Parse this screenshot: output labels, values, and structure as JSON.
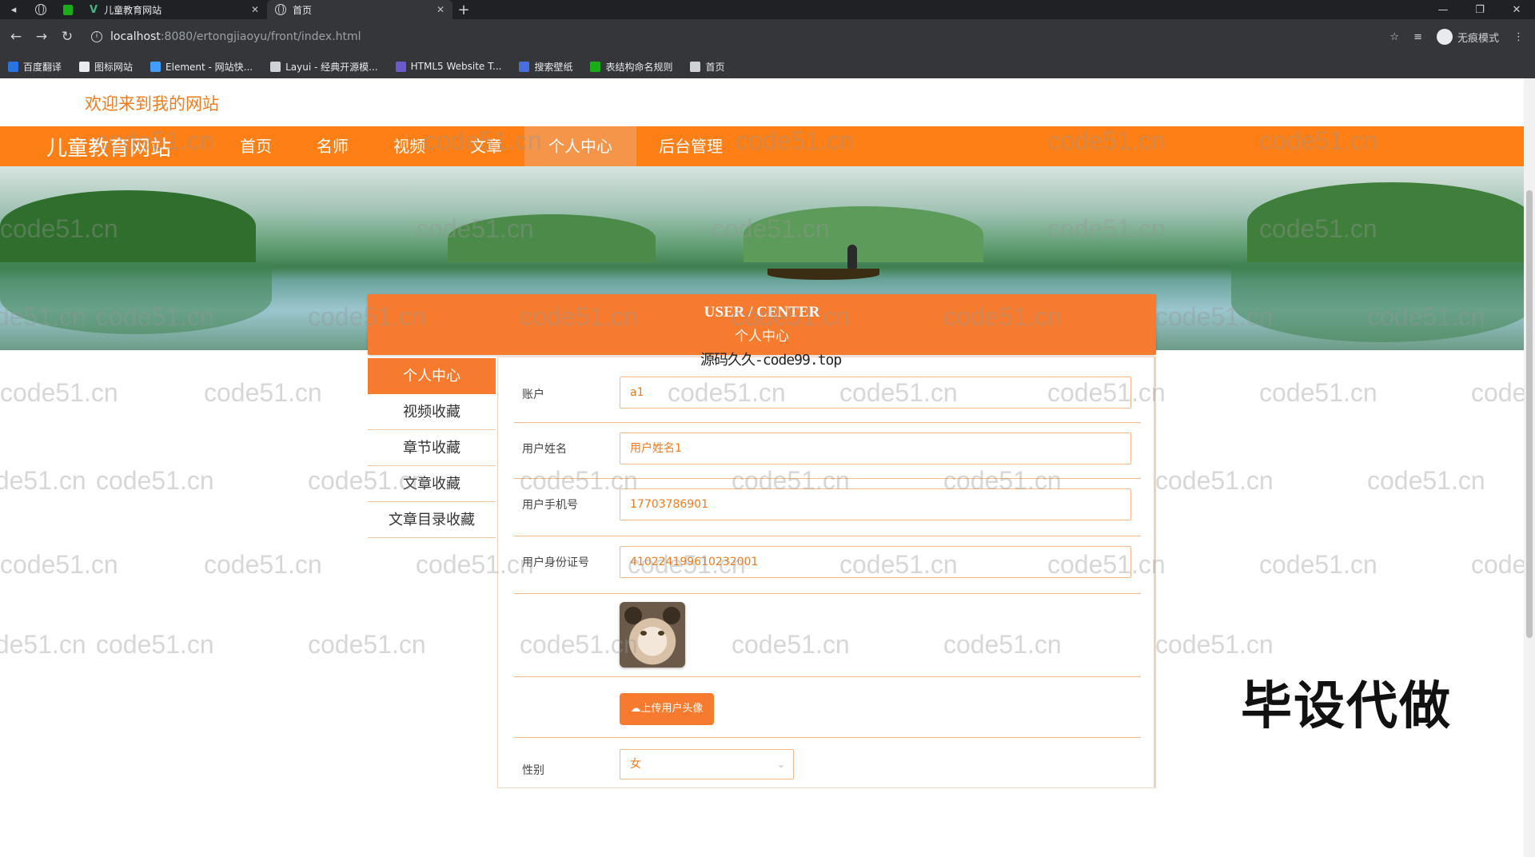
{
  "browser": {
    "tabs": [
      {
        "title": "儿童教育网站"
      },
      {
        "title": "首页"
      }
    ],
    "url_host": "localhost",
    "url_path": ":8080/ertongjiaoyu/front/index.html",
    "incognito_label": "无痕模式",
    "bookmarks": [
      {
        "label": "百度翻译",
        "color": "#2b73e0"
      },
      {
        "label": "图标网站",
        "color": "#e8eaed"
      },
      {
        "label": "Element - 网站快...",
        "color": "#409eff"
      },
      {
        "label": "Layui - 经典开源模...",
        "color": "#cfd2d6"
      },
      {
        "label": "HTML5 Website T...",
        "color": "#6a5acd"
      },
      {
        "label": "搜索壁纸",
        "color": "#4a6ee0"
      },
      {
        "label": "表结构命名规则",
        "color": "#1aad19"
      },
      {
        "label": "首页",
        "color": "#cfd2d6"
      }
    ]
  },
  "site": {
    "welcome": "欢迎来到我的网站",
    "brand": "儿童教育网站",
    "nav": [
      "首页",
      "名师",
      "视频",
      "文章",
      "个人中心",
      "后台管理"
    ],
    "active_nav": "个人中心",
    "banner_slides": 3,
    "banner_active_slide": 1
  },
  "center": {
    "title_en": "USER / CENTER",
    "title_zh": "个人中心",
    "source_note": "源码久久-code99.top",
    "side_menu": [
      "个人中心",
      "视频收藏",
      "章节收藏",
      "文章收藏",
      "文章目录收藏"
    ],
    "form": {
      "account_label": "账户",
      "account_value": "a1",
      "name_label": "用户姓名",
      "name_value": "用户姓名1",
      "phone_label": "用户手机号",
      "phone_value": "17703786901",
      "idcard_label": "用户身份证号",
      "idcard_value": "410224199610232001",
      "upload_label": "上传用户头像",
      "gender_label": "性别",
      "gender_value": "女"
    }
  },
  "watermark_text": "code51.cn",
  "overlay_text": "毕设代做",
  "colors": {
    "accent": "#fe7f15",
    "accent_dark": "#f77b2e"
  }
}
